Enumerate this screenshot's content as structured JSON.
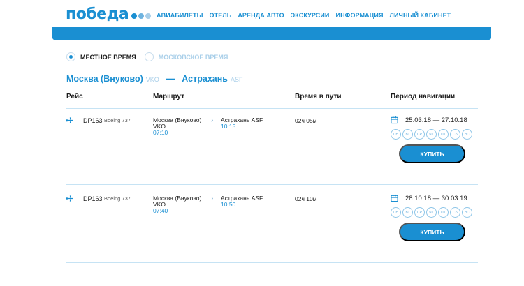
{
  "header": {
    "logo_text": "победа",
    "logo_dot_colors": [
      "#1a8fd2",
      "#6fb3df",
      "#a9cfe9"
    ],
    "nav": [
      "АВИАБИЛЕТЫ",
      "ОТЕЛЬ",
      "АРЕНДА АВТО",
      "ЭКСКУРСИИ",
      "ИНФОРМАЦИЯ",
      "ЛИЧНЫЙ КАБИНЕТ"
    ]
  },
  "time_toggle": {
    "local": "МЕСТНОЕ ВРЕМЯ",
    "moscow": "МОСКОВСКОЕ ВРЕМЯ",
    "selected": "local"
  },
  "route": {
    "from_city": "Москва (Внуково)",
    "from_code": "VKO",
    "separator": "—",
    "to_city": "Астрахань",
    "to_code": "ASF"
  },
  "table": {
    "headers": [
      "Рейс",
      "Маршрут",
      "Время в пути",
      "Период навигации"
    ],
    "rows": [
      {
        "flight": "DP163",
        "aircraft": "Boeing 737",
        "dep_city": "Москва (Внуково)",
        "dep_code": "VKO",
        "dep_time": "07:10",
        "arr_city": "Астрахань ASF",
        "arr_time": "10:15",
        "duration": "02ч 05м",
        "period": "25.03.18 — 27.10.18",
        "days": [
          "пн",
          "вт",
          "ср",
          "чт",
          "пт",
          "сб",
          "вс"
        ],
        "buy": "КУПИТЬ"
      },
      {
        "flight": "DP163",
        "aircraft": "Boeing 737",
        "dep_city": "Москва (Внуково)",
        "dep_code": "VKO",
        "dep_time": "07:40",
        "arr_city": "Астрахань ASF",
        "arr_time": "10:50",
        "duration": "02ч 10м",
        "period": "28.10.18 — 30.03.19",
        "days": [
          "пн",
          "вт",
          "ср",
          "чт",
          "пт",
          "сб",
          "вс"
        ],
        "buy": "КУПИТЬ"
      }
    ]
  },
  "icons": {
    "plane": "plane-icon",
    "calendar": "calendar-icon",
    "chevron": "chevron-right-icon"
  },
  "colors": {
    "brand": "#1a8fd2",
    "light": "#a9cfe9"
  }
}
